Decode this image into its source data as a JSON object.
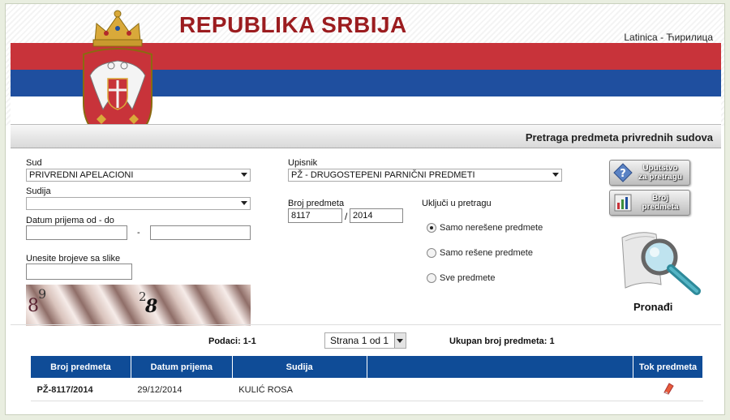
{
  "header": {
    "title": "REPUBLIKA SRBIJA",
    "lang_latin": "Latinica",
    "lang_sep": "-",
    "lang_cyrillic": "Ћирилица",
    "subtitle": "Pretraga predmeta privrednih sudova",
    "flag_colors": [
      "#c8333a",
      "#1f4f9f",
      "#ffffff"
    ]
  },
  "form": {
    "sud_label": "Sud",
    "sud_value": "PRIVREDNI APELACIONI",
    "sudija_label": "Sudija",
    "sudija_value": "",
    "datum_label": "Datum prijema od - do",
    "datum_sep": "-",
    "datum_od": "",
    "datum_do": "",
    "captcha_label": "Unesite brojeve sa slike",
    "captcha_value": "",
    "captcha_digits": [
      "8",
      "9",
      "2",
      "8"
    ],
    "upisnik_label": "Upisnik",
    "upisnik_value": "PŽ - DRUGOSTEPENI PARNIČNI PREDMETI",
    "broj_label": "Broj predmeta",
    "broj_value": "8117",
    "broj_sep": "/",
    "godina_value": "2014",
    "ukljuci_label": "Uključi u pretragu",
    "radios": [
      {
        "label": "Samo nerešene predmete",
        "checked": true
      },
      {
        "label": "Samo rešene predmete",
        "checked": false
      },
      {
        "label": "Sve predmete",
        "checked": false
      }
    ]
  },
  "buttons": {
    "uputstvo_line1": "Uputstvo",
    "uputstvo_line2": "za pretragu",
    "broj_line1": "Broj",
    "broj_line2": "predmeta",
    "pronadji": "Pronađi"
  },
  "results": {
    "podaci": "Podaci: 1-1",
    "strana": "Strana 1 od 1",
    "ukupno": "Ukupan broj predmeta: 1",
    "columns": [
      "Broj predmeta",
      "Datum prijema",
      "Sudija",
      "",
      "Tok predmeta"
    ],
    "rows": [
      {
        "broj": "PŽ-8117/2014",
        "datum": "29/12/2014",
        "sudija": "KULIĆ ROSA",
        "extra": ""
      }
    ]
  }
}
